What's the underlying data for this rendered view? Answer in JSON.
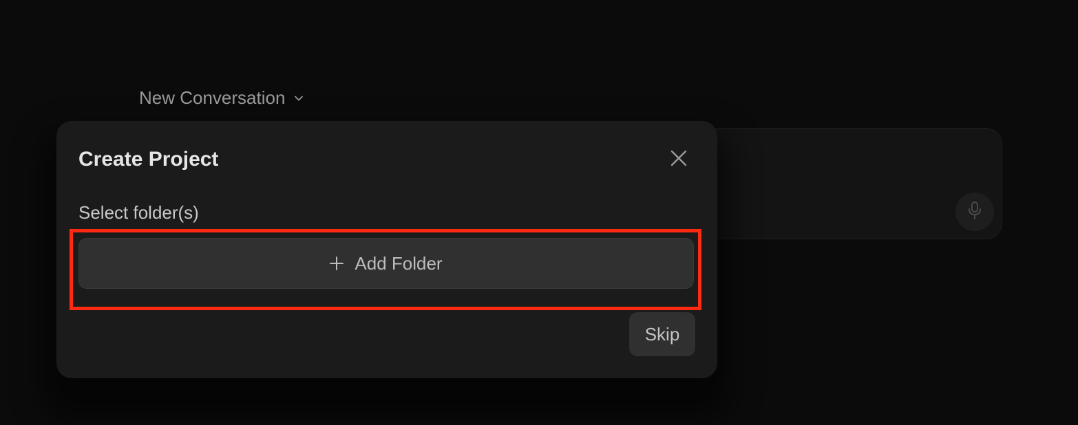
{
  "header": {
    "conversation_title": "New Conversation",
    "dropdown_icon": "chevron-down-icon"
  },
  "composer": {
    "mic_icon": "microphone-icon"
  },
  "modal": {
    "title": "Create Project",
    "close_icon": "close-icon",
    "folder_label": "Select folder(s)",
    "add_folder_label": "Add Folder",
    "add_icon": "plus-icon",
    "skip_label": "Skip"
  },
  "colors": {
    "background": "#0b0b0b",
    "modal_background": "#1b1b1b",
    "button_background": "#303030",
    "highlight": "#ff2a12"
  }
}
